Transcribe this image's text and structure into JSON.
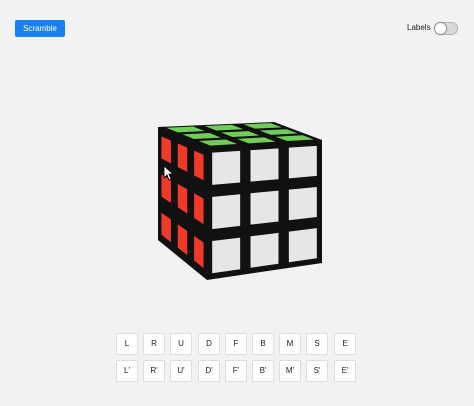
{
  "toolbar": {
    "scramble_label": "Scramble"
  },
  "labels_toggle": {
    "label": "Labels",
    "on": false
  },
  "cube": {
    "colors": {
      "top": "#6fce58",
      "left": "#ef3a2a",
      "front": "#e6e6e6",
      "frame": "#111111"
    }
  },
  "moves": {
    "row1": [
      "L",
      "R",
      "U",
      "D",
      "F",
      "B",
      "M",
      "S",
      "E"
    ],
    "row2": [
      "L'",
      "R'",
      "U'",
      "D'",
      "F'",
      "B'",
      "M'",
      "S'",
      "E'"
    ]
  }
}
